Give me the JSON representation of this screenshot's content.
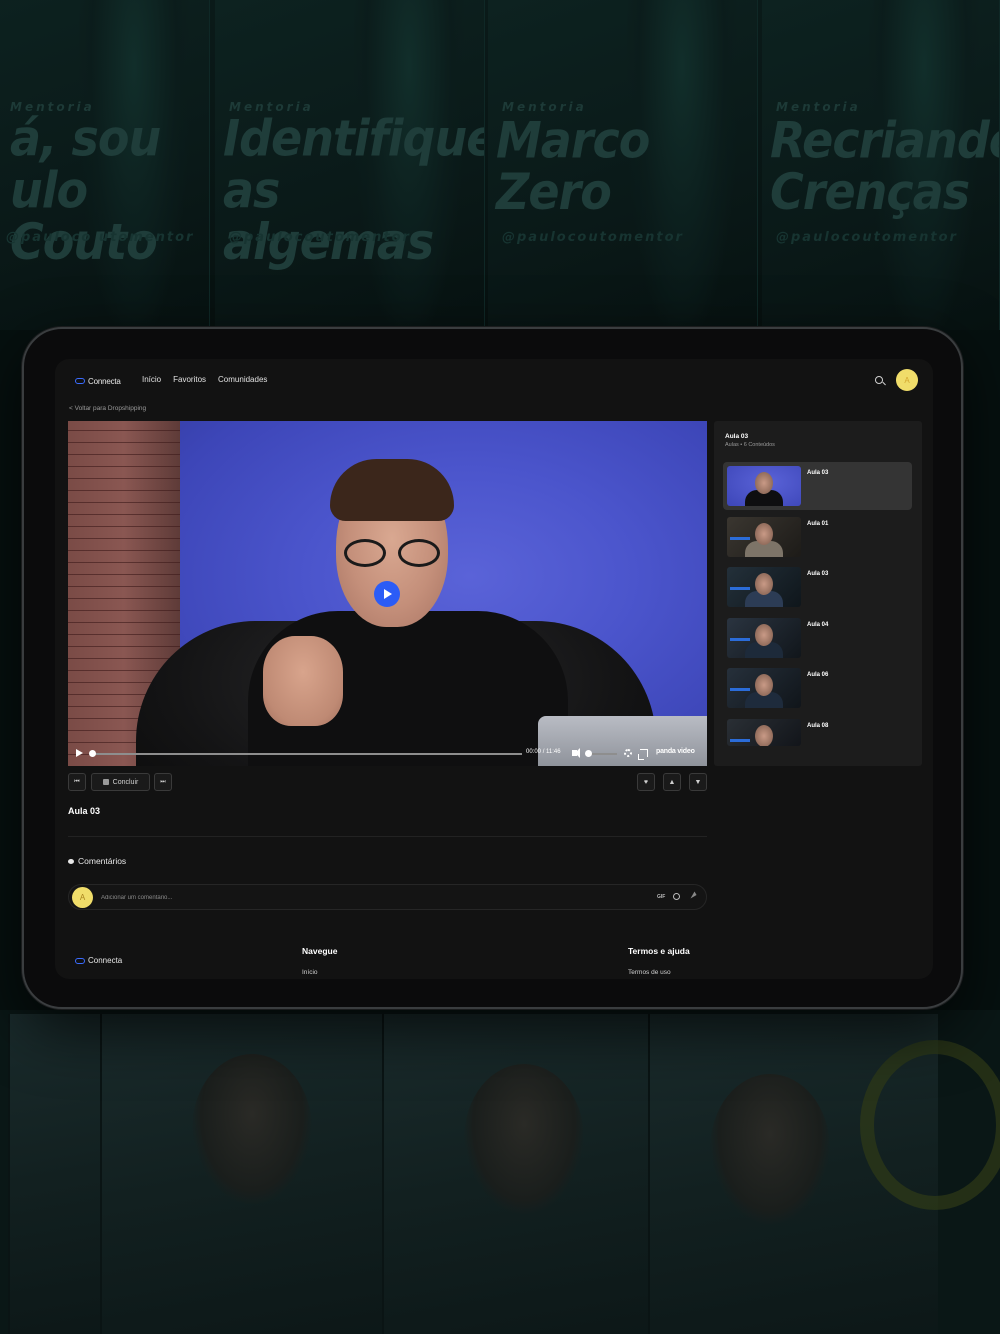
{
  "background": {
    "posters": [
      {
        "kicker": "Mentoria",
        "title": "á, sou ulo Couto",
        "handle": "@pauloco utomentor"
      },
      {
        "kicker": "Mentoria",
        "title": "Identifique as algemas",
        "handle": "@paulocoutomentor"
      },
      {
        "kicker": "Mentoria",
        "title": "Marco Zero",
        "handle": "@paulocoutomentor"
      },
      {
        "kicker": "Mentoria",
        "title": "Recriando Crenças",
        "handle": "@paulocoutomentor"
      }
    ]
  },
  "header": {
    "logo_text": "Connecta",
    "nav": [
      "Início",
      "Favoritos",
      "Comunidades"
    ],
    "avatar_initial": "A"
  },
  "back_link": "< Voltar para Dropshipping",
  "player": {
    "current_time": "00:00",
    "separator": "/",
    "duration": "11:46",
    "brand": "panda video",
    "progress": 0
  },
  "actions": {
    "complete_label": "Concluir"
  },
  "lesson": {
    "title": "Aula 03"
  },
  "comments": {
    "heading": "Comentários",
    "avatar_initial": "A",
    "placeholder": "Adicionar um comentário...",
    "gif_label": "GIF"
  },
  "footer": {
    "logo_text": "Connecta",
    "nav_heading": "Navegue",
    "nav_link": "Início",
    "terms_heading": "Termos e ajuda",
    "terms_link": "Termos de uso"
  },
  "sidebar": {
    "title": "Aula 03",
    "subtitle": "Aulas • 6 Conteúdos",
    "items": [
      {
        "label": "Aula 03",
        "active": true
      },
      {
        "label": "Aula 01",
        "active": false
      },
      {
        "label": "Aula 03",
        "active": false
      },
      {
        "label": "Aula 04",
        "active": false
      },
      {
        "label": "Aula 06",
        "active": false
      },
      {
        "label": "Aula 08",
        "active": false
      }
    ]
  },
  "colors": {
    "accent": "#2b5cf6",
    "avatar": "#f0dd6a",
    "surface": "#121212",
    "sidebar": "#1c1c1c"
  }
}
